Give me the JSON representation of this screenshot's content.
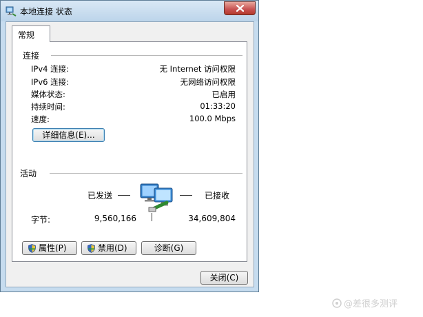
{
  "window": {
    "title": "本地连接 状态"
  },
  "tabs": [
    {
      "label": "常规"
    }
  ],
  "connection": {
    "section_label": "连接",
    "rows": [
      {
        "label": "IPv4 连接:",
        "value": "无 Internet 访问权限"
      },
      {
        "label": "IPv6 连接:",
        "value": "无网络访问权限"
      },
      {
        "label": "媒体状态:",
        "value": "已启用"
      },
      {
        "label": "持续时间:",
        "value": "01:33:20"
      },
      {
        "label": "速度:",
        "value": "100.0 Mbps"
      }
    ],
    "details_button": "详细信息(E)..."
  },
  "activity": {
    "section_label": "活动",
    "sent_label": "已发送",
    "received_label": "已接收",
    "bytes_label": "字节:",
    "bytes_sent": "9,560,166",
    "bytes_received": "34,609,804"
  },
  "buttons": {
    "properties": "属性(P)",
    "disable": "禁用(D)",
    "diagnose": "诊断(G)",
    "close": "关闭(C)"
  },
  "watermark": {
    "text": "@差很多测评"
  },
  "icons": {
    "title": "network-connection-icon",
    "activity": "network-computers-icon",
    "shield": "uac-shield-icon"
  }
}
